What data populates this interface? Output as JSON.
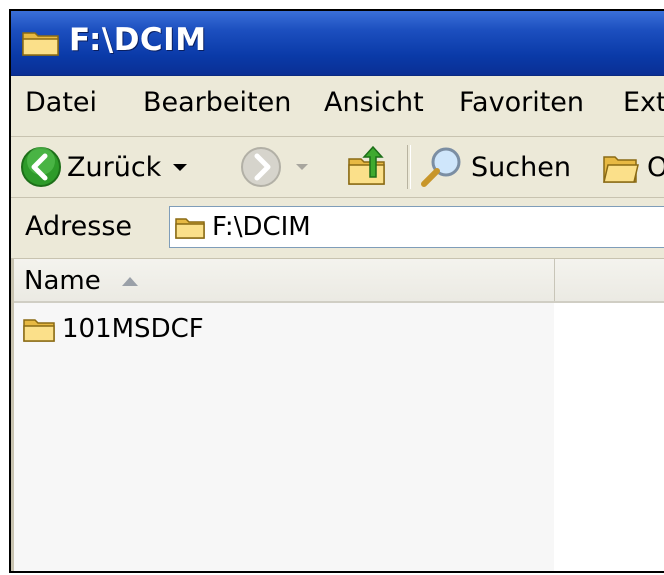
{
  "window": {
    "title": "F:\\DCIM"
  },
  "menu": {
    "items": [
      "Datei",
      "Bearbeiten",
      "Ansicht",
      "Favoriten",
      "Ext"
    ]
  },
  "toolbar": {
    "back_label": "Zurück",
    "search_label": "Suchen",
    "folders_label": "O"
  },
  "address": {
    "label": "Adresse",
    "value": "F:\\DCIM"
  },
  "list": {
    "column_name": "Name",
    "items": [
      {
        "name": "101MSDCF",
        "icon": "folder-icon"
      }
    ]
  },
  "colors": {
    "titlebar": "#0a3aa8",
    "chrome": "#ece9d8",
    "back_arrow": "#2e9b2a"
  }
}
